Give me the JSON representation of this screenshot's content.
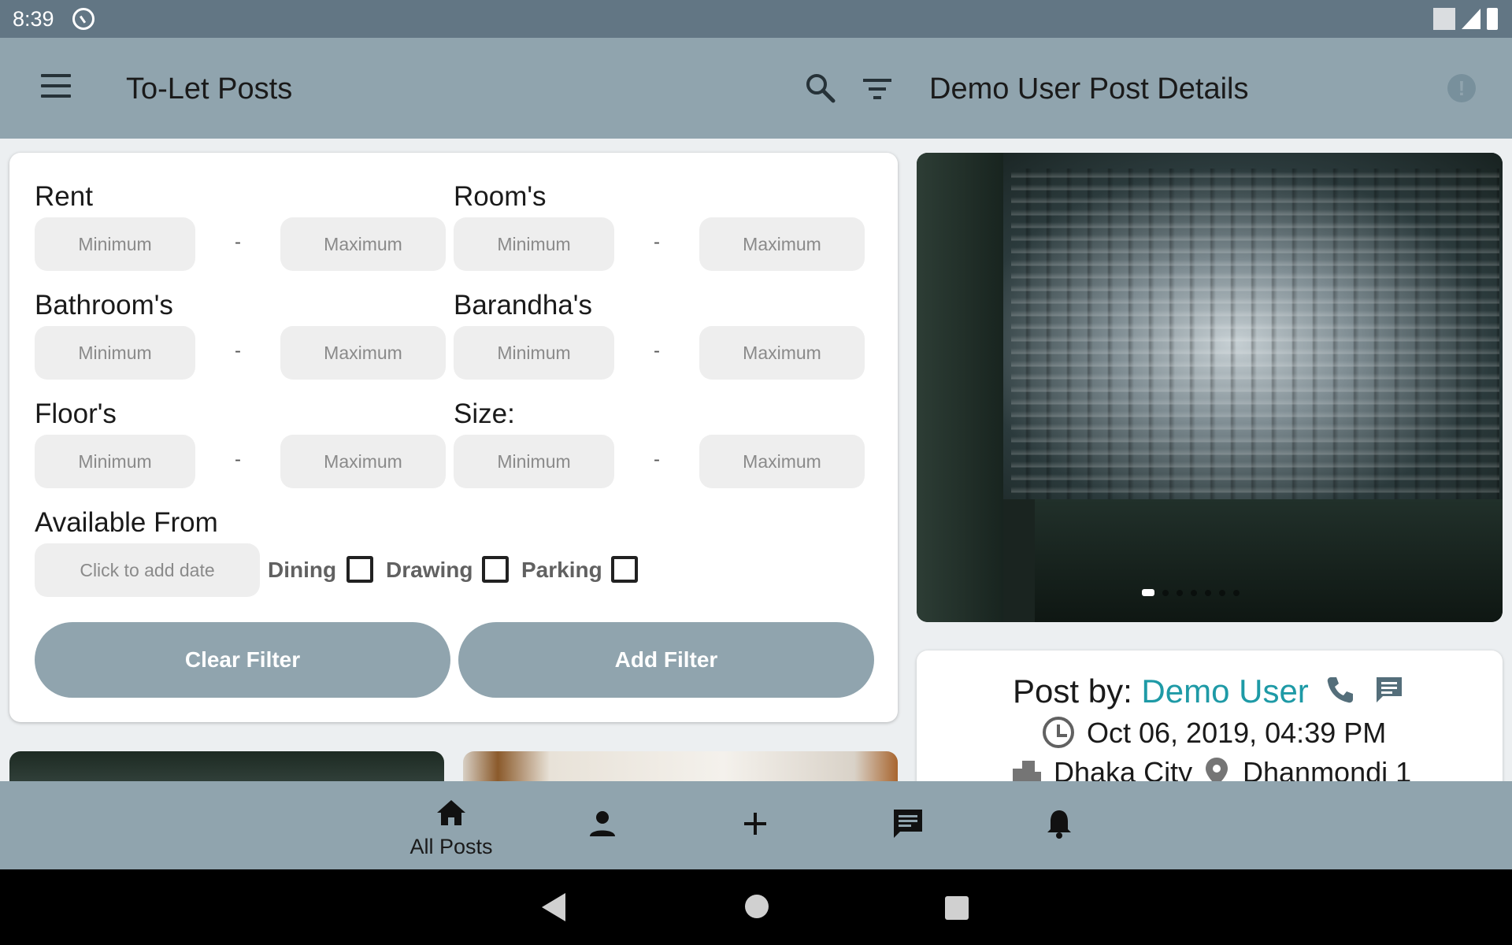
{
  "status_bar": {
    "time": "8:39"
  },
  "app_bar": {
    "title": "To-Let Posts",
    "detail_title": "Demo User Post Details"
  },
  "filter": {
    "rent_label": "Rent",
    "rooms_label": "Room's",
    "bathrooms_label": "Bathroom's",
    "barandhas_label": "Barandha's",
    "floors_label": "Floor's",
    "size_label": "Size:",
    "min_placeholder": "Minimum",
    "max_placeholder": "Maximum",
    "dash": "-",
    "available_from_label": "Available From",
    "date_placeholder": "Click to add date",
    "dining_label": "Dining",
    "drawing_label": "Drawing",
    "parking_label": "Parking",
    "clear_button": "Clear Filter",
    "add_button": "Add Filter"
  },
  "post_detail": {
    "post_by_prefix": "Post by: ",
    "user_name": "Demo User",
    "date": "Oct 06, 2019, 04:39 PM",
    "city": "Dhaka City",
    "area": "Dhanmondi 1",
    "image_count": 7,
    "active_image_index": 0
  },
  "bottom_nav": {
    "all_posts_label": "All Posts"
  },
  "colors": {
    "status_bar": "#627684",
    "app_bar": "#90a4ae",
    "accent_link": "#1e9aa6",
    "input_bg": "#eeeeee"
  },
  "icons": [
    "menu-icon",
    "search-icon",
    "filter-icon",
    "report-icon",
    "phone-icon",
    "chat-icon",
    "clock-icon",
    "city-icon",
    "location-pin-icon",
    "home-icon",
    "person-icon",
    "add-icon",
    "message-icon",
    "bell-icon"
  ]
}
